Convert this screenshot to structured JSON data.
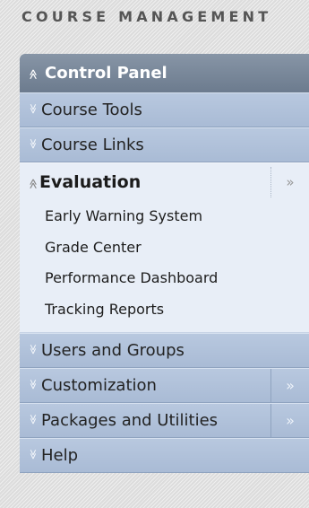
{
  "header": {
    "title": "COURSE MANAGEMENT"
  },
  "control_panel": {
    "title": "Control Panel",
    "sections_top": [
      {
        "label": "Course Tools"
      },
      {
        "label": "Course Links"
      }
    ],
    "expanded": {
      "label": "Evaluation",
      "items": [
        "Early Warning System",
        "Grade Center",
        "Performance Dashboard",
        "Tracking Reports"
      ]
    },
    "sections_bottom": [
      {
        "label": "Users and Groups"
      },
      {
        "label": "Customization"
      },
      {
        "label": "Packages and Utilities"
      },
      {
        "label": "Help"
      }
    ],
    "glyphs": {
      "expand": "≫",
      "collapse": "≫",
      "more": "»"
    }
  }
}
